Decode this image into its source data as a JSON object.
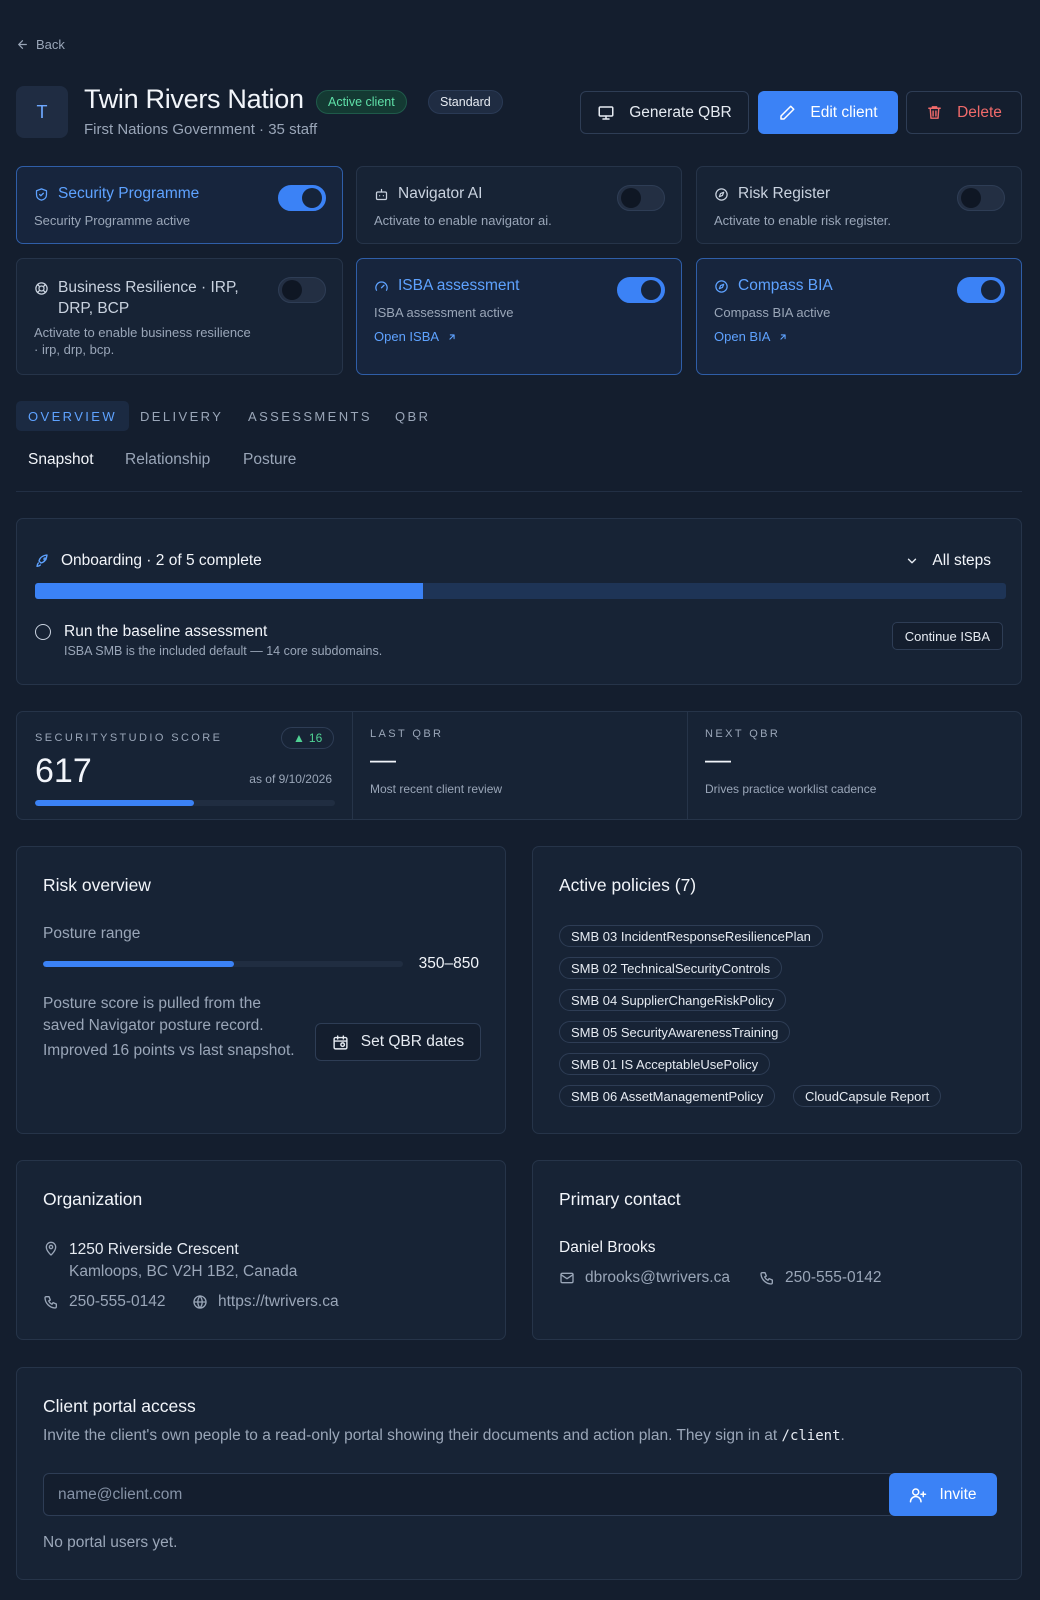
{
  "nav": {
    "back_label": "Back"
  },
  "client": {
    "initial": "T",
    "name": "Twin Rivers Nation",
    "subtitle": "First Nations Government · 35 staff",
    "status_badge": "Active client",
    "tier_badge": "Standard"
  },
  "actions": {
    "generate_qbr": "Generate QBR",
    "edit": "Edit client",
    "delete": "Delete"
  },
  "modules": [
    {
      "title": "Security Programme",
      "desc": "Security Programme active",
      "enabled": true,
      "icon": "shield-icon"
    },
    {
      "title": "Navigator AI",
      "desc": "Activate to enable navigator ai.",
      "enabled": false,
      "icon": "bot-icon"
    },
    {
      "title": "Risk Register",
      "desc": "Activate to enable risk register.",
      "enabled": false,
      "icon": "compass-icon"
    },
    {
      "title": "Business Resilience · IRP, DRP, BCP",
      "title_line1": "Business Resilience · IRP,",
      "title_line2": "DRP, BCP",
      "desc": "Activate to enable business resilience · irp, drp, bcp.",
      "desc_line1": "Activate to enable business resilience",
      "desc_line2": "· irp, drp, bcp.",
      "enabled": false,
      "icon": "lifebuoy-icon"
    },
    {
      "title": "ISBA assessment",
      "desc": "ISBA assessment active",
      "link": "Open ISBA",
      "enabled": true,
      "icon": "gauge-icon"
    },
    {
      "title": "Compass BIA",
      "desc": "Compass BIA active",
      "link": "Open BIA",
      "enabled": true,
      "icon": "compass-icon"
    }
  ],
  "tabs": [
    "OVERVIEW",
    "DELIVERY",
    "ASSESSMENTS",
    "QBR"
  ],
  "subtabs": [
    "Snapshot",
    "Relationship",
    "Posture"
  ],
  "onboarding": {
    "title": "Onboarding · 2 of 5 complete",
    "toggle_label": "All steps",
    "progress_fraction": 0.4,
    "step_title": "Run the baseline assessment",
    "step_desc": "ISBA SMB is the included default — 14 core subdomains.",
    "step_button": "Continue ISBA"
  },
  "stats": {
    "score_label": "SECURITYSTUDIO SCORE",
    "score_value": "617",
    "score_delta": "16",
    "score_date": "as of 9/10/2026",
    "score_fraction": 0.53,
    "last_qbr_label": "LAST QBR",
    "last_qbr_value": "—",
    "last_qbr_sub": "Most recent client review",
    "next_qbr_label": "NEXT QBR",
    "next_qbr_value": "—",
    "next_qbr_sub": "Drives practice worklist cadence"
  },
  "risk": {
    "title": "Risk overview",
    "range_label": "Posture range",
    "range_value": "350–850",
    "range_fraction": 0.53,
    "note_line1": "Posture score is pulled from the",
    "note_line2": "saved Navigator posture record.",
    "note_line3": "Improved 16 points vs last snapshot.",
    "set_dates": "Set QBR dates"
  },
  "policies": {
    "title": "Active policies (7)",
    "items": [
      "SMB 03 IncidentResponseResiliencePlan",
      "SMB 02 TechnicalSecurityControls",
      "SMB 04 SupplierChangeRiskPolicy",
      "SMB 05 SecurityAwarenessTraining",
      "SMB 01 IS AcceptableUsePolicy",
      "SMB 06 AssetManagementPolicy",
      "CloudCapsule Report"
    ]
  },
  "organization": {
    "title": "Organization",
    "address_line1": "1250 Riverside Crescent",
    "address_line2": "Kamloops, BC V2H 1B2, Canada",
    "phone": "250-555-0142",
    "website": "https://twrivers.ca"
  },
  "contact": {
    "title": "Primary contact",
    "name": "Daniel Brooks",
    "email": "dbrooks@twrivers.ca",
    "phone": "250-555-0142"
  },
  "portal": {
    "title": "Client portal access",
    "desc_prefix": "Invite the client's own people to a read-only portal showing their documents and action plan. They sign in at",
    "desc_path": "/client",
    "desc_suffix": ".",
    "placeholder": "name@client.com",
    "invite": "Invite",
    "empty": "No portal users yet."
  },
  "colors": {
    "accent": "#3b82f6",
    "success": "#5fe0a8",
    "danger": "#f06a6a",
    "background": "#141e2e",
    "card": "#172335"
  }
}
